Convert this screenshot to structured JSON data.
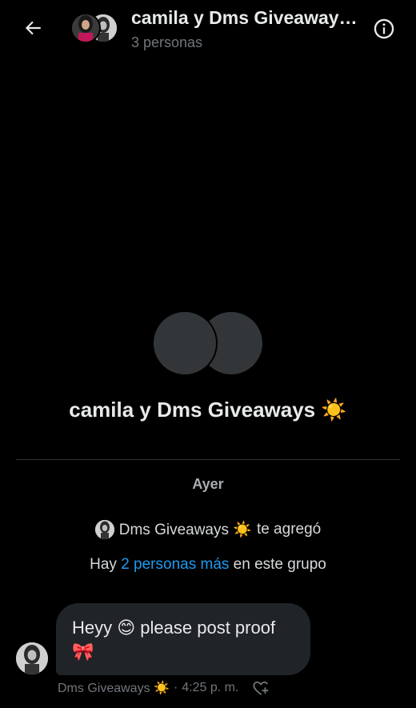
{
  "header": {
    "title": "camila y Dms Giveaways ☀️",
    "subtitle": "3 personas"
  },
  "group": {
    "name": "camila y Dms Giveaways ☀️"
  },
  "timeline": {
    "day_label": "Ayer",
    "added_by": "Dms Giveaways ☀️",
    "added_text": "te agregó",
    "members_prefix": "Hay",
    "members_link": "2 personas más",
    "members_suffix": "en este grupo"
  },
  "message": {
    "text_line1": "Heyy 😊 please post proof",
    "text_line2": "🎀",
    "sender": "Dms Giveaways ☀️",
    "separator": "·",
    "time": "4:25 p. m."
  },
  "icons": {
    "back": "arrow-left-icon",
    "info": "info-circle-icon",
    "react": "heart-plus-icon"
  }
}
